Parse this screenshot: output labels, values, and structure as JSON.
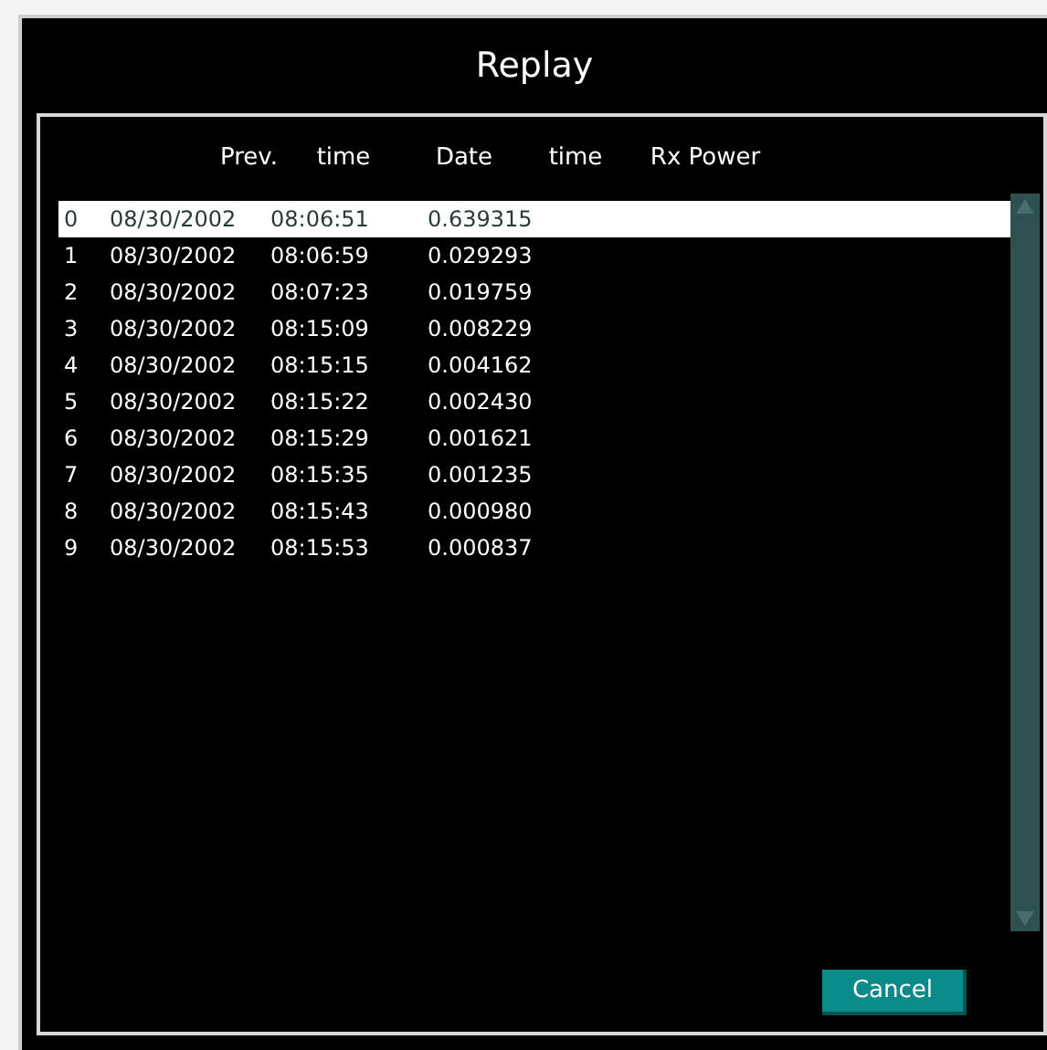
{
  "window": {
    "title": "Replay"
  },
  "table": {
    "columns": [
      "Prev.",
      "time",
      "Date",
      "time",
      "Rx Power"
    ],
    "rows": [
      {
        "index": "0",
        "date": "08/30/2002",
        "time": "08:06:51",
        "value": "0.639315",
        "selected": true
      },
      {
        "index": "1",
        "date": "08/30/2002",
        "time": "08:06:59",
        "value": "0.029293",
        "selected": false
      },
      {
        "index": "2",
        "date": "08/30/2002",
        "time": "08:07:23",
        "value": "0.019759",
        "selected": false
      },
      {
        "index": "3",
        "date": "08/30/2002",
        "time": "08:15:09",
        "value": "0.008229",
        "selected": false
      },
      {
        "index": "4",
        "date": "08/30/2002",
        "time": "08:15:15",
        "value": "0.004162",
        "selected": false
      },
      {
        "index": "5",
        "date": "08/30/2002",
        "time": "08:15:22",
        "value": "0.002430",
        "selected": false
      },
      {
        "index": "6",
        "date": "08/30/2002",
        "time": "08:15:29",
        "value": "0.001621",
        "selected": false
      },
      {
        "index": "7",
        "date": "08/30/2002",
        "time": "08:15:35",
        "value": "0.001235",
        "selected": false
      },
      {
        "index": "8",
        "date": "08/30/2002",
        "time": "08:15:43",
        "value": "0.000980",
        "selected": false
      },
      {
        "index": "9",
        "date": "08/30/2002",
        "time": "08:15:53",
        "value": "0.000837",
        "selected": false
      }
    ]
  },
  "buttons": [
    "Cancel"
  ]
}
